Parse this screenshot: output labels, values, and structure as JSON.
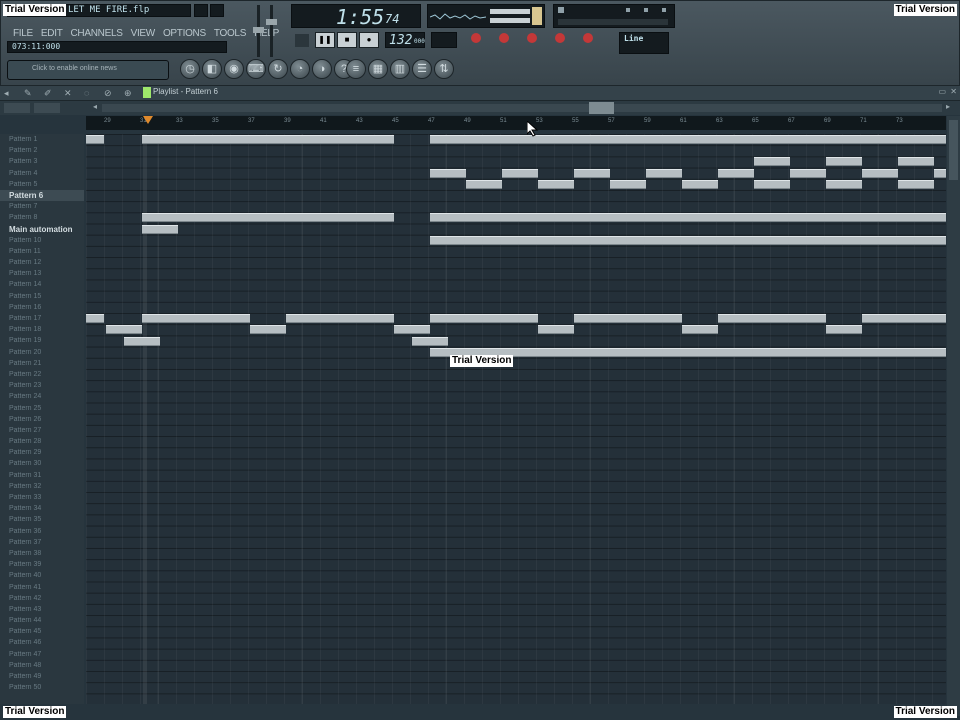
{
  "watermark": {
    "label": "Trial Version"
  },
  "app": {
    "filename": "LET ME FIRE.flp",
    "position": "073:11:000",
    "hint": "Click to enable online news"
  },
  "menu": [
    "FILE",
    "EDIT",
    "CHANNELS",
    "VIEW",
    "OPTIONS",
    "TOOLS",
    "HELP"
  ],
  "transport": {
    "time_main": "1:55",
    "time_sub": "74",
    "tempo": "132",
    "tempo_sub": "000",
    "input_label": "Line"
  },
  "playlist": {
    "title": "Playlist - Pattern 6"
  },
  "ruler": [
    "29",
    "31",
    "33",
    "35",
    "37",
    "39",
    "41",
    "43",
    "45",
    "47",
    "49",
    "51",
    "53",
    "55",
    "57",
    "59",
    "61",
    "63",
    "65",
    "67",
    "69",
    "71",
    "73"
  ],
  "tracks": [
    "Pattern 1",
    "Pattern 2",
    "Pattern 3",
    "Pattern 4",
    "Pattern 5",
    "Pattern 6",
    "Pattern 7",
    "Pattern 8",
    "Main automation",
    "Pattern 10",
    "Pattern 11",
    "Pattern 12",
    "Pattern 13",
    "Pattern 14",
    "Pattern 15",
    "Pattern 16",
    "Pattern 17",
    "Pattern 18",
    "Pattern 19",
    "Pattern 20",
    "Pattern 21",
    "Pattern 22",
    "Pattern 23",
    "Pattern 24",
    "Pattern 25",
    "Pattern 26",
    "Pattern 27",
    "Pattern 28",
    "Pattern 29",
    "Pattern 30",
    "Pattern 31",
    "Pattern 32",
    "Pattern 33",
    "Pattern 34",
    "Pattern 35",
    "Pattern 36",
    "Pattern 37",
    "Pattern 38",
    "Pattern 39",
    "Pattern 40",
    "Pattern 41",
    "Pattern 42",
    "Pattern 43",
    "Pattern 44",
    "Pattern 45",
    "Pattern 46",
    "Pattern 47",
    "Pattern 48",
    "Pattern 49",
    "Pattern 50"
  ],
  "colors": {
    "bg": "#26343d",
    "clip": "#b6bec2",
    "accent": "#9ee86b",
    "marker": "#e08a2c"
  }
}
